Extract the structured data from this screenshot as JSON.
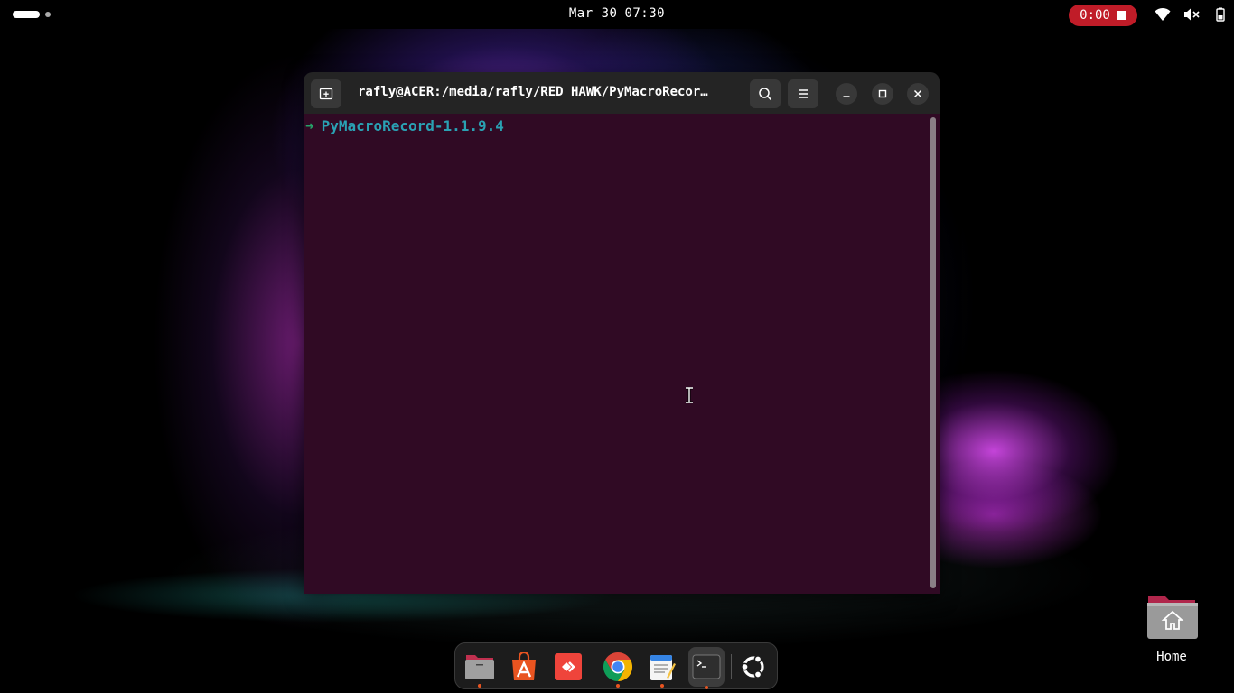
{
  "topbar": {
    "date": "Mar 30",
    "time": "07:30",
    "recording_time": "0:00",
    "tray_icons": [
      "wifi-icon",
      "volume-muted-icon",
      "battery-icon"
    ]
  },
  "terminal": {
    "title": "rafly@ACER:/media/rafly/RED HAWK/PyMacroRecor…",
    "prompt_arrow": "➜",
    "prompt_dir": "PyMacroRecord-1.1.9.4",
    "colors": {
      "background": "#300a24",
      "arrow": "#26a269",
      "dir": "#2aa1b3"
    }
  },
  "desktop": {
    "home_label": "Home"
  },
  "dock": {
    "apps": [
      {
        "name": "files",
        "icon": "folder-icon",
        "running": true
      },
      {
        "name": "app-center",
        "icon": "app-center-icon",
        "running": false
      },
      {
        "name": "anydesk",
        "icon": "anydesk-icon",
        "running": false
      },
      {
        "name": "chrome",
        "icon": "chrome-icon",
        "running": true
      },
      {
        "name": "text-editor",
        "icon": "text-editor-icon",
        "running": true
      },
      {
        "name": "terminal",
        "icon": "terminal-icon",
        "running": true,
        "focused": true
      },
      {
        "name": "show-apps",
        "icon": "ubuntu-logo-icon",
        "running": false
      }
    ]
  }
}
